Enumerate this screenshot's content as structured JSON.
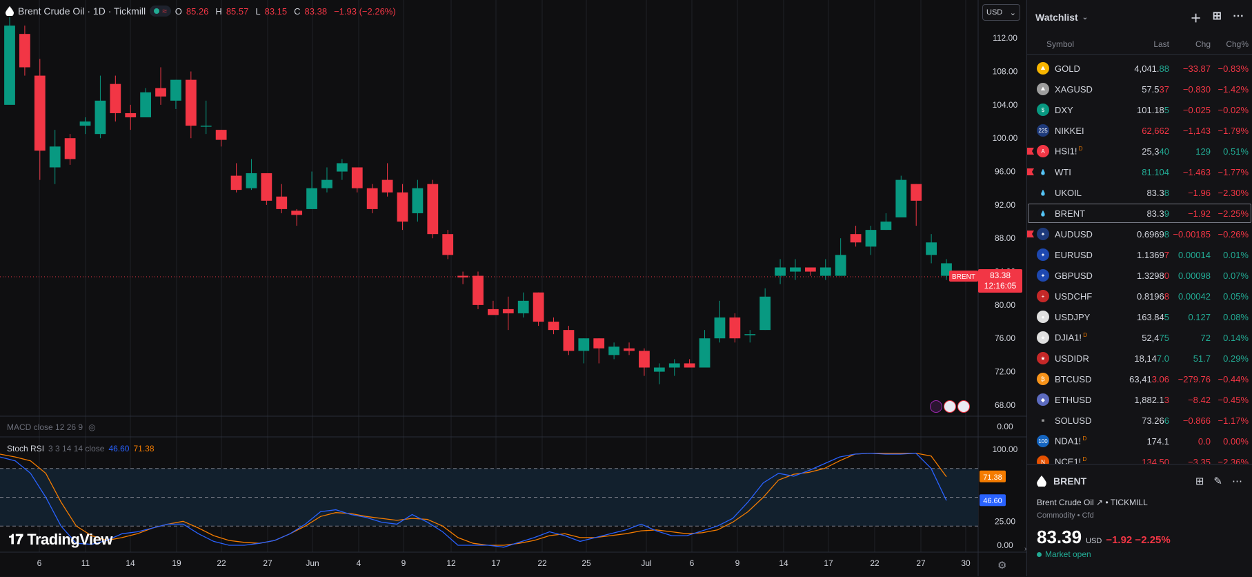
{
  "legend": {
    "title": "Brent Crude Oil · 1D · Tickmill",
    "wave": "≈",
    "o_label": "O",
    "o": "85.26",
    "h_label": "H",
    "h": "85.57",
    "l_label": "L",
    "l": "83.15",
    "c_label": "C",
    "c": "83.38",
    "change": "−1.93 (−2.26%)"
  },
  "currency": "USD",
  "macd_label": "MACD close 12 26 9",
  "stoch": {
    "label": "Stoch RSI",
    "params": "3 3 14 14 close",
    "k": "46.60",
    "d": "71.38"
  },
  "brand": "TradingView",
  "colors": {
    "up": "#089981",
    "down": "#f23645",
    "k_line": "#2962ff",
    "d_line": "#f57c00"
  },
  "chart_data": {
    "type": "candlestick",
    "price_axis": [
      "112.00",
      "108.00",
      "104.00",
      "100.00",
      "96.00",
      "92.00",
      "88.00",
      "84.00",
      "80.00",
      "76.00",
      "72.00",
      "68.00"
    ],
    "price_range": [
      66.5,
      114.5
    ],
    "last_price_label": {
      "symbol": "BRENT",
      "price": "83.38",
      "time": "12:16:05",
      "value": 83.38
    },
    "x_labels": [
      "6",
      "11",
      "14",
      "19",
      "22",
      "27",
      "Jun",
      "4",
      "9",
      "12",
      "17",
      "22",
      "25",
      "Jul",
      "6",
      "9",
      "14",
      "17",
      "22",
      "27",
      "30"
    ],
    "candles": [
      [
        104.0,
        114.5,
        104.5,
        113.5
      ],
      [
        112.5,
        113.5,
        107.5,
        108.5
      ],
      [
        107.5,
        109.5,
        95.0,
        98.5
      ],
      [
        96.5,
        101.0,
        94.5,
        99.0
      ],
      [
        100.0,
        100.5,
        96.8,
        97.5
      ],
      [
        101.5,
        102.5,
        100.5,
        102.0
      ],
      [
        100.5,
        107.5,
        100.0,
        104.5
      ],
      [
        106.5,
        107.5,
        102.0,
        103.0
      ],
      [
        103.0,
        104.0,
        101.0,
        102.5
      ],
      [
        102.5,
        106.0,
        102.5,
        105.5
      ],
      [
        106.0,
        108.5,
        104.0,
        105.0
      ],
      [
        104.5,
        107.0,
        103.5,
        107.0
      ],
      [
        107.0,
        108.0,
        100.0,
        101.5
      ],
      [
        101.5,
        104.5,
        100.5,
        101.5
      ],
      [
        101.0,
        101.0,
        99.0,
        99.8
      ],
      [
        95.5,
        97.0,
        93.5,
        93.8
      ],
      [
        94.0,
        97.5,
        93.8,
        95.8
      ],
      [
        95.8,
        95.8,
        92.0,
        92.5
      ],
      [
        93.0,
        94.5,
        91.0,
        91.5
      ],
      [
        91.3,
        91.5,
        89.5,
        90.8
      ],
      [
        91.5,
        96.0,
        91.5,
        94.0
      ],
      [
        94.0,
        96.5,
        93.5,
        95.0
      ],
      [
        96.0,
        97.5,
        95.0,
        97.0
      ],
      [
        96.5,
        96.5,
        93.5,
        94.0
      ],
      [
        94.0,
        94.5,
        91.0,
        91.5
      ],
      [
        95.0,
        97.0,
        93.0,
        93.5
      ],
      [
        93.5,
        94.5,
        89.0,
        90.0
      ],
      [
        91.0,
        95.0,
        90.0,
        94.0
      ],
      [
        94.5,
        95.0,
        88.0,
        88.5
      ],
      [
        88.5,
        89.0,
        85.5,
        86.0
      ],
      [
        83.5,
        84.0,
        82.5,
        83.3
      ],
      [
        83.5,
        84.0,
        79.5,
        80.0
      ],
      [
        79.5,
        80.5,
        79.0,
        78.8
      ],
      [
        79.5,
        81.0,
        77.0,
        79.0
      ],
      [
        79.0,
        81.5,
        78.5,
        80.5
      ],
      [
        81.5,
        81.5,
        77.5,
        78.0
      ],
      [
        78.0,
        78.5,
        76.5,
        77.0
      ],
      [
        77.0,
        77.5,
        74.0,
        74.5
      ],
      [
        74.5,
        76.0,
        73.0,
        76.0
      ],
      [
        76.0,
        76.0,
        73.0,
        74.8
      ],
      [
        74.0,
        75.5,
        73.5,
        75.0
      ],
      [
        74.8,
        75.5,
        74.0,
        74.5
      ],
      [
        74.5,
        74.8,
        71.5,
        72.5
      ],
      [
        72.0,
        73.0,
        70.5,
        72.5
      ],
      [
        72.5,
        73.5,
        71.5,
        73.0
      ],
      [
        73.0,
        73.5,
        72.5,
        72.5
      ],
      [
        72.5,
        77.0,
        72.5,
        76.0
      ],
      [
        76.0,
        80.5,
        75.5,
        78.5
      ],
      [
        78.5,
        79.0,
        75.5,
        76.0
      ],
      [
        76.5,
        77.0,
        75.5,
        76.5
      ],
      [
        77.0,
        82.0,
        77.0,
        81.0
      ],
      [
        83.5,
        85.5,
        82.5,
        84.5
      ],
      [
        84.0,
        85.5,
        83.0,
        84.5
      ],
      [
        84.5,
        84.5,
        83.5,
        84.0
      ],
      [
        83.5,
        85.5,
        83.0,
        84.5
      ],
      [
        83.5,
        88.0,
        83.5,
        86.0
      ],
      [
        88.5,
        89.5,
        87.0,
        87.5
      ],
      [
        87.0,
        89.5,
        86.0,
        89.0
      ],
      [
        89.0,
        91.0,
        89.0,
        90.0
      ],
      [
        90.5,
        95.5,
        90.5,
        95.0
      ],
      [
        94.5,
        94.5,
        89.5,
        92.5
      ],
      [
        86.0,
        88.5,
        85.0,
        87.5
      ],
      [
        83.5,
        85.5,
        83.0,
        85.0
      ]
    ],
    "stoch_axis": [
      "100.00",
      "25.00",
      "0.00"
    ],
    "macd_axis": "0.00",
    "stoch_k": [
      92,
      88,
      75,
      50,
      20,
      2,
      1,
      5,
      12,
      14,
      18,
      22,
      22,
      12,
      4,
      0,
      0,
      2,
      5,
      12,
      22,
      35,
      37,
      32,
      29,
      24,
      22,
      32,
      24,
      14,
      0,
      0,
      0,
      -2,
      3,
      8,
      14,
      10,
      4,
      8,
      12,
      16,
      22,
      15,
      10,
      10,
      15,
      20,
      28,
      45,
      65,
      75,
      72,
      78,
      85,
      92,
      95,
      96,
      95,
      95,
      96,
      80,
      46.6
    ],
    "stoch_d": [
      95,
      92,
      88,
      75,
      45,
      20,
      10,
      5,
      8,
      12,
      18,
      22,
      25,
      18,
      10,
      5,
      3,
      2,
      5,
      12,
      20,
      30,
      34,
      33,
      30,
      28,
      26,
      28,
      27,
      20,
      8,
      2,
      0,
      0,
      2,
      5,
      10,
      12,
      8,
      8,
      10,
      12,
      15,
      16,
      14,
      12,
      13,
      16,
      24,
      35,
      50,
      68,
      74,
      76,
      80,
      88,
      95,
      96,
      96,
      96,
      96,
      93,
      71.38
    ]
  },
  "watchlist": {
    "title": "Watchlist",
    "col_symbol": "Symbol",
    "col_last": "Last",
    "col_chg": "Chg",
    "col_pct": "Chg%",
    "items": [
      {
        "sym": "GOLD",
        "last_main": "4,041.",
        "last_tail": "88",
        "tail_dir": "up",
        "chg": "−33.87",
        "pct": "−0.83%",
        "dir": "dn",
        "icon": "#f7b500",
        "glyph": "⛰",
        "flag": false,
        "badge": ""
      },
      {
        "sym": "XAGUSD",
        "last_main": "57.5",
        "last_tail": "37",
        "tail_dir": "dn",
        "chg": "−0.830",
        "pct": "−1.42%",
        "dir": "dn",
        "icon": "#9e9e9e",
        "glyph": "⛰",
        "flag": false,
        "badge": ""
      },
      {
        "sym": "DXY",
        "last_main": "101.18",
        "last_tail": "5",
        "tail_dir": "up",
        "chg": "−0.025",
        "pct": "−0.02%",
        "dir": "dn",
        "icon": "#089981",
        "glyph": "$",
        "flag": false,
        "badge": ""
      },
      {
        "sym": "NIKKEI",
        "last_main": "62,662",
        "last_tail": "",
        "tail_dir": "dn",
        "chg": "−1,143",
        "pct": "−1.79%",
        "dir": "dn",
        "icon": "#1e3a7b",
        "glyph": "225",
        "flag": false,
        "badge": "",
        "last_color": "dn"
      },
      {
        "sym": "HSI1!",
        "last_main": "25,3",
        "last_tail": "40",
        "tail_dir": "up",
        "chg": "129",
        "pct": "0.51%",
        "dir": "up",
        "icon": "#f23645",
        "glyph": "A",
        "flag": true,
        "badge": "D"
      },
      {
        "sym": "WTI",
        "last_main": "81.104",
        "last_tail": "",
        "tail_dir": "up",
        "chg": "−1.463",
        "pct": "−1.77%",
        "dir": "dn",
        "icon": "#131316",
        "glyph": "💧",
        "flag": true,
        "badge": "",
        "last_color": "up"
      },
      {
        "sym": "UKOIL",
        "last_main": "83.3",
        "last_tail": "8",
        "tail_dir": "up",
        "chg": "−1.96",
        "pct": "−2.30%",
        "dir": "dn",
        "icon": "#131316",
        "glyph": "💧",
        "flag": false,
        "badge": ""
      },
      {
        "sym": "BRENT",
        "last_main": "83.3",
        "last_tail": "9",
        "tail_dir": "up",
        "chg": "−1.92",
        "pct": "−2.25%",
        "dir": "dn",
        "icon": "#131316",
        "glyph": "💧",
        "flag": false,
        "badge": "",
        "active": true
      },
      {
        "sym": "AUDUSD",
        "last_main": "0.6969",
        "last_tail": "8",
        "tail_dir": "up",
        "chg": "−0.00185",
        "pct": "−0.26%",
        "dir": "dn",
        "icon": "#1e3a7b",
        "glyph": "✦",
        "flag": true,
        "badge": ""
      },
      {
        "sym": "EURUSD",
        "last_main": "1.1369",
        "last_tail": "7",
        "tail_dir": "dn",
        "chg": "0.00014",
        "pct": "0.01%",
        "dir": "up",
        "icon": "#1e48b0",
        "glyph": "✦",
        "flag": false,
        "badge": ""
      },
      {
        "sym": "GBPUSD",
        "last_main": "1.3298",
        "last_tail": "0",
        "tail_dir": "dn",
        "chg": "0.00098",
        "pct": "0.07%",
        "dir": "up",
        "icon": "#1e48b0",
        "glyph": "✦",
        "flag": false,
        "badge": ""
      },
      {
        "sym": "USDCHF",
        "last_main": "0.8196",
        "last_tail": "8",
        "tail_dir": "dn",
        "chg": "0.00042",
        "pct": "0.05%",
        "dir": "up",
        "icon": "#c62828",
        "glyph": "+",
        "flag": false,
        "badge": ""
      },
      {
        "sym": "USDJPY",
        "last_main": "163.84",
        "last_tail": "5",
        "tail_dir": "up",
        "chg": "0.127",
        "pct": "0.08%",
        "dir": "up",
        "icon": "#e0e0e0",
        "glyph": "●",
        "flag": false,
        "badge": ""
      },
      {
        "sym": "DJIA1!",
        "last_main": "52,4",
        "last_tail": "75",
        "tail_dir": "up",
        "chg": "72",
        "pct": "0.14%",
        "dir": "up",
        "icon": "#e0e0e0",
        "glyph": "★",
        "flag": false,
        "badge": "D"
      },
      {
        "sym": "USDIDR",
        "last_main": "18,14",
        "last_tail": "7.0",
        "tail_dir": "up",
        "chg": "51.7",
        "pct": "0.29%",
        "dir": "up",
        "icon": "#c62828",
        "glyph": "★",
        "flag": false,
        "badge": ""
      },
      {
        "sym": "BTCUSD",
        "last_main": "63,41",
        "last_tail": "3.06",
        "tail_dir": "dn",
        "chg": "−279.76",
        "pct": "−0.44%",
        "dir": "dn",
        "icon": "#f7931a",
        "glyph": "₿",
        "flag": false,
        "badge": ""
      },
      {
        "sym": "ETHUSD",
        "last_main": "1,882.1",
        "last_tail": "3",
        "tail_dir": "dn",
        "chg": "−8.42",
        "pct": "−0.45%",
        "dir": "dn",
        "icon": "#5c6bc0",
        "glyph": "◆",
        "flag": false,
        "badge": ""
      },
      {
        "sym": "SOLUSD",
        "last_main": "73.26",
        "last_tail": "6",
        "tail_dir": "up",
        "chg": "−0.866",
        "pct": "−1.17%",
        "dir": "dn",
        "icon": "#131316",
        "glyph": "≡",
        "flag": false,
        "badge": ""
      },
      {
        "sym": "NDA1!",
        "last_main": "174.1",
        "last_tail": "",
        "tail_dir": "up",
        "chg": "0.0",
        "pct": "0.00%",
        "dir": "dn",
        "icon": "#1565c0",
        "glyph": "100",
        "flag": false,
        "badge": "D"
      },
      {
        "sym": "NCE1!",
        "last_main": "134.50",
        "last_tail": "",
        "tail_dir": "dn",
        "chg": "−3.35",
        "pct": "−2.36%",
        "dir": "dn",
        "icon": "#e65100",
        "glyph": "N",
        "flag": false,
        "badge": "D",
        "last_color": "dn"
      }
    ]
  },
  "detail": {
    "symbol": "BRENT",
    "name": "Brent Crude Oil",
    "exchange": "• TICKMILL",
    "category": "Commodity • Cfd",
    "price": "83.39",
    "currency": "USD",
    "change": "−1.92  −2.25%",
    "status": "Market open"
  }
}
